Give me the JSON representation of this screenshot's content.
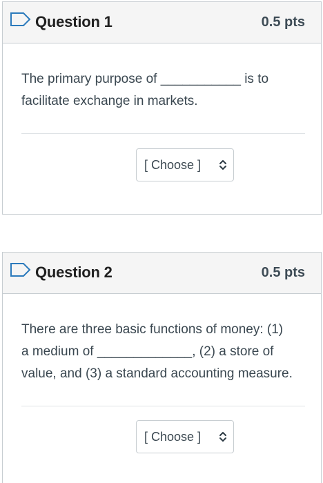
{
  "questions": [
    {
      "title": "Question 1",
      "points": "0.5 pts",
      "text_line1": "The primary purpose of ___________ is to",
      "text_line2": "facilitate exchange in markets.",
      "select_value": "[ Choose ]"
    },
    {
      "title": "Question 2",
      "points": "0.5 pts",
      "text_line1": "There are three basic functions of money: (1)",
      "text_line2": "a medium of _____________, (2) a store of",
      "text_line3": "value, and (3) a standard accounting measure.",
      "select_value": "[ Choose ]"
    }
  ],
  "icons": {
    "flag": "flag-outline-icon",
    "select_arrows": "up-down-chevron-icon"
  },
  "colors": {
    "header_bg": "#f5f5f5",
    "border": "#c7cdd1",
    "flag_stroke": "#2b7abc",
    "title_text": "#1f1f1f",
    "body_text": "#3a4750"
  }
}
